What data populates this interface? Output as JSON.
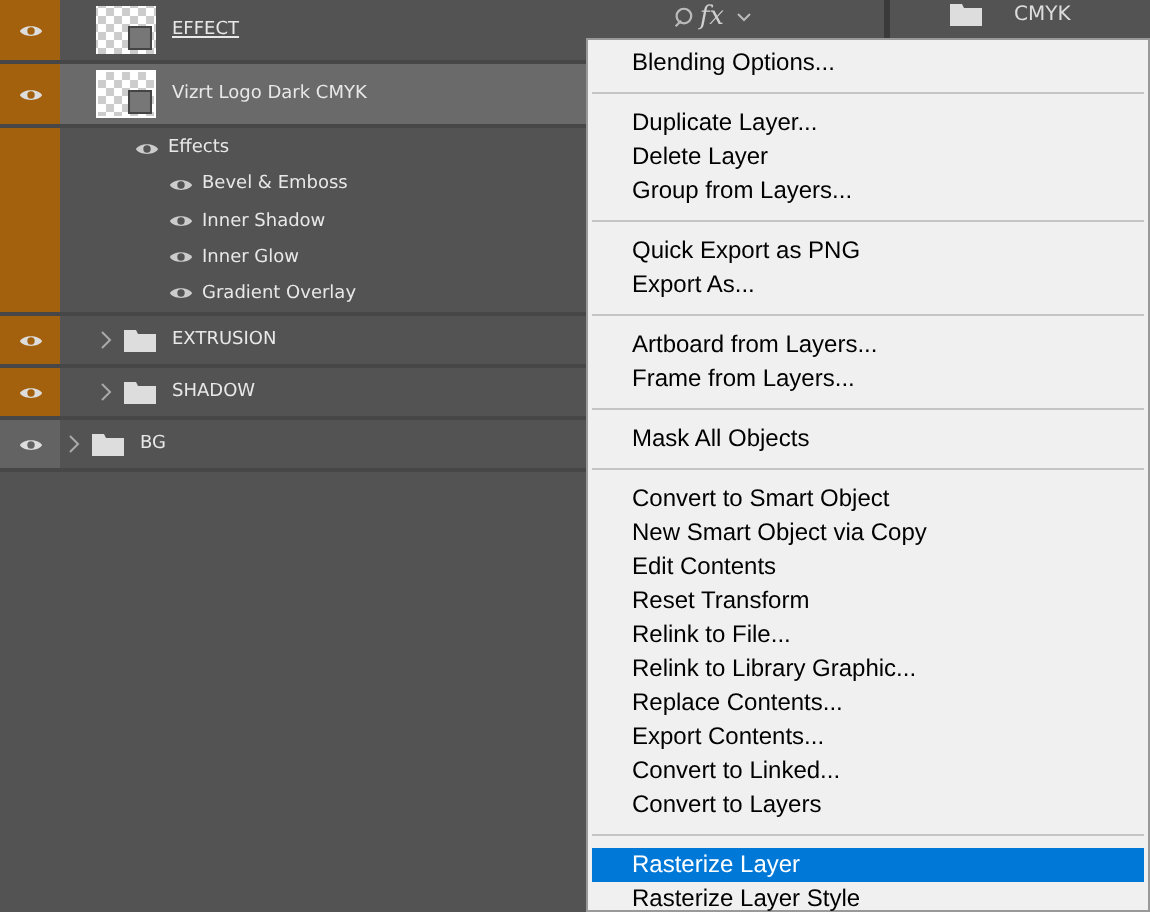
{
  "layers": [
    {
      "name": "EFFECT",
      "kind": "smart",
      "visible": true,
      "selected": false,
      "color": "#a3600d",
      "editing": true,
      "fx_label": "fx"
    },
    {
      "name": "Vizrt Logo Dark CMYK",
      "kind": "smart",
      "visible": true,
      "selected": true,
      "color": "#a3600d",
      "editing": false,
      "effects": {
        "label": "Effects",
        "visible": true,
        "items": [
          {
            "name": "Bevel & Emboss",
            "visible": true
          },
          {
            "name": "Inner Shadow",
            "visible": true
          },
          {
            "name": "Inner Glow",
            "visible": true
          },
          {
            "name": "Gradient Overlay",
            "visible": true
          }
        ]
      }
    },
    {
      "name": "EXTRUSION",
      "kind": "group",
      "visible": true,
      "selected": false,
      "color": "#a3600d",
      "expanded": false,
      "nested": true
    },
    {
      "name": "SHADOW",
      "kind": "group",
      "visible": true,
      "selected": false,
      "color": "#a3600d",
      "expanded": false,
      "nested": true
    },
    {
      "name": "BG",
      "kind": "group",
      "visible": true,
      "selected": false,
      "expanded": false,
      "nested": false
    }
  ],
  "side_panel": {
    "layer_name": "CMYK"
  },
  "context_menu": {
    "groups": [
      {
        "items": [
          {
            "label": "Blending Options...",
            "selected": false
          }
        ]
      },
      {
        "items": [
          {
            "label": "Duplicate Layer...",
            "selected": false
          },
          {
            "label": "Delete Layer",
            "selected": false
          },
          {
            "label": "Group from Layers...",
            "selected": false
          }
        ]
      },
      {
        "items": [
          {
            "label": "Quick Export as PNG",
            "selected": false
          },
          {
            "label": "Export As...",
            "selected": false
          }
        ]
      },
      {
        "items": [
          {
            "label": "Artboard from Layers...",
            "selected": false
          },
          {
            "label": "Frame from Layers...",
            "selected": false
          }
        ]
      },
      {
        "items": [
          {
            "label": "Mask All Objects",
            "selected": false
          }
        ]
      },
      {
        "items": [
          {
            "label": "Convert to Smart Object",
            "selected": false
          },
          {
            "label": "New Smart Object via Copy",
            "selected": false
          },
          {
            "label": "Edit Contents",
            "selected": false
          },
          {
            "label": "Reset Transform",
            "selected": false
          },
          {
            "label": "Relink to File...",
            "selected": false
          },
          {
            "label": "Relink to Library Graphic...",
            "selected": false
          },
          {
            "label": "Replace Contents...",
            "selected": false
          },
          {
            "label": "Export Contents...",
            "selected": false
          },
          {
            "label": "Convert to Linked...",
            "selected": false
          },
          {
            "label": "Convert to Layers",
            "selected": false
          }
        ]
      },
      {
        "items": [
          {
            "label": "Rasterize Layer",
            "selected": true
          },
          {
            "label": "Rasterize Layer Style",
            "selected": false
          }
        ]
      }
    ]
  }
}
